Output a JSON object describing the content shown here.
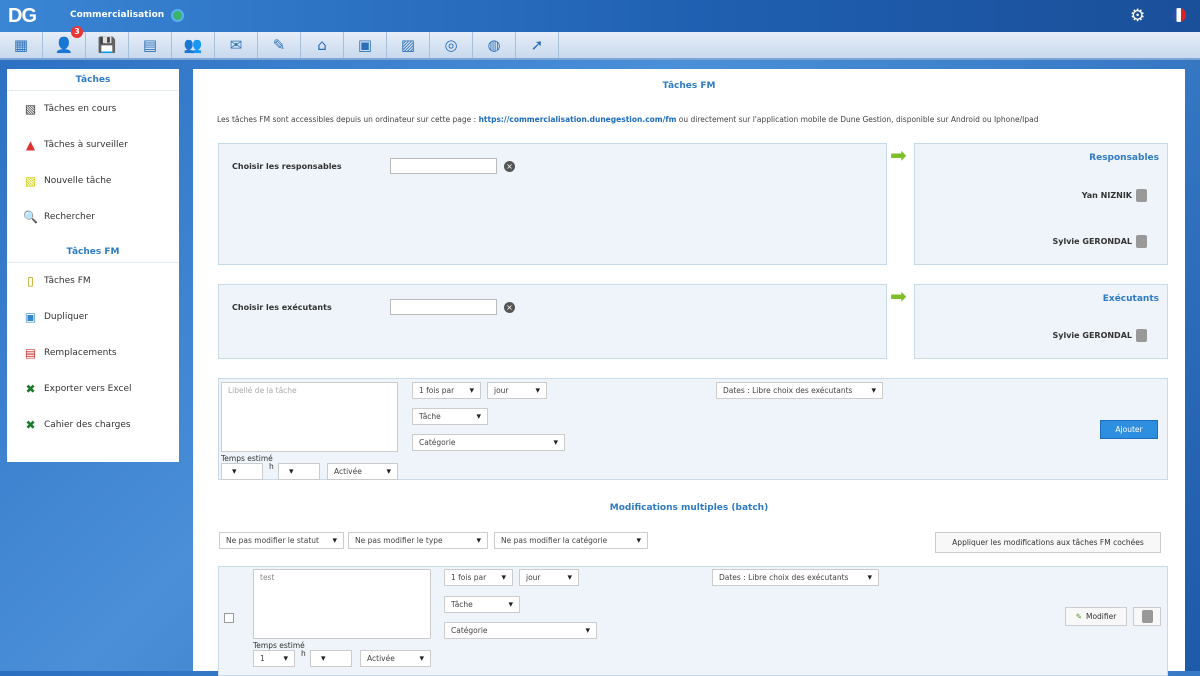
{
  "header": {
    "logo": "DG",
    "title": "Commercialisation",
    "settings_icon": "gear-icon",
    "language": "fr"
  },
  "toolbar": {
    "items": [
      {
        "name": "dashboard",
        "glyph": "▦"
      },
      {
        "name": "users",
        "glyph": "👤",
        "badge": "3"
      },
      {
        "name": "save",
        "glyph": "💾"
      },
      {
        "name": "table",
        "glyph": "▤"
      },
      {
        "name": "contacts",
        "glyph": "👥"
      },
      {
        "name": "mail",
        "glyph": "✉"
      },
      {
        "name": "edit",
        "glyph": "✎"
      },
      {
        "name": "home",
        "glyph": "⌂"
      },
      {
        "name": "boxes",
        "glyph": "▣"
      },
      {
        "name": "notes",
        "glyph": "▨"
      },
      {
        "name": "coins",
        "glyph": "◎"
      },
      {
        "name": "globe",
        "glyph": "◍"
      },
      {
        "name": "tools",
        "glyph": "➚"
      }
    ]
  },
  "sidebar": {
    "section1": "Tâches",
    "items1": [
      {
        "label": "Tâches en cours",
        "glyph": "▧",
        "color": "#333"
      },
      {
        "label": "Tâches à surveiller",
        "glyph": "▲",
        "color": "#d33"
      },
      {
        "label": "Nouvelle tâche",
        "glyph": "▧",
        "color": "#cc0"
      },
      {
        "label": "Rechercher",
        "glyph": "🔍",
        "color": "#27c"
      }
    ],
    "section2": "Tâches FM",
    "items2": [
      {
        "label": "Tâches FM",
        "glyph": "▯",
        "color": "#b90"
      },
      {
        "label": "Dupliquer",
        "glyph": "▣",
        "color": "#38c"
      },
      {
        "label": "Remplacements",
        "glyph": "▤",
        "color": "#c33"
      },
      {
        "label": "Exporter vers Excel",
        "glyph": "✖",
        "color": "#1a7a2a"
      },
      {
        "label": "Cahier des charges",
        "glyph": "✖",
        "color": "#1a7a2a"
      }
    ]
  },
  "main": {
    "title": "Tâches FM",
    "info_before": "Les tâches FM sont accessibles depuis un ordinateur sur cette page : ",
    "info_link": "https://commercialisation.dunegestion.com/fm",
    "info_after": " ou directement sur l'application mobile de Dune Gestion, disponible sur Android ou Iphone/Ipad",
    "responsables": {
      "label": "Choisir les responsables",
      "title": "Responsables",
      "people": [
        "Yan NIZNIK",
        "Sylvie GERONDAL"
      ]
    },
    "executants": {
      "label": "Choisir les exécutants",
      "title": "Exécutants",
      "people": [
        "Sylvie GERONDAL"
      ]
    },
    "new_task": {
      "placeholder": "Libellé de la tâche",
      "frequency": "1 fois par",
      "period": "jour",
      "type": "Tâche",
      "category": "Catégorie",
      "dates": "Dates : Libre choix des exécutants",
      "time_label": "Temps estimé",
      "hours": "",
      "h": "h",
      "minutes": "",
      "status": "Activée",
      "add": "Ajouter"
    },
    "batch": {
      "title": "Modifications multiples (batch)",
      "status": "Ne pas modifier le statut",
      "type": "Ne pas modifier le type",
      "category": "Ne pas modifier la catégorie",
      "apply": "Appliquer les modifications aux tâches FM cochées"
    },
    "row": {
      "label": "test",
      "frequency": "1 fois par",
      "period": "jour",
      "type": "Tâche",
      "category": "Catégorie",
      "dates": "Dates : Libre choix des exécutants",
      "time_label": "Temps estimé",
      "hours": "1",
      "h": "h",
      "minutes": "",
      "status": "Activée",
      "modify": "Modifier"
    }
  }
}
